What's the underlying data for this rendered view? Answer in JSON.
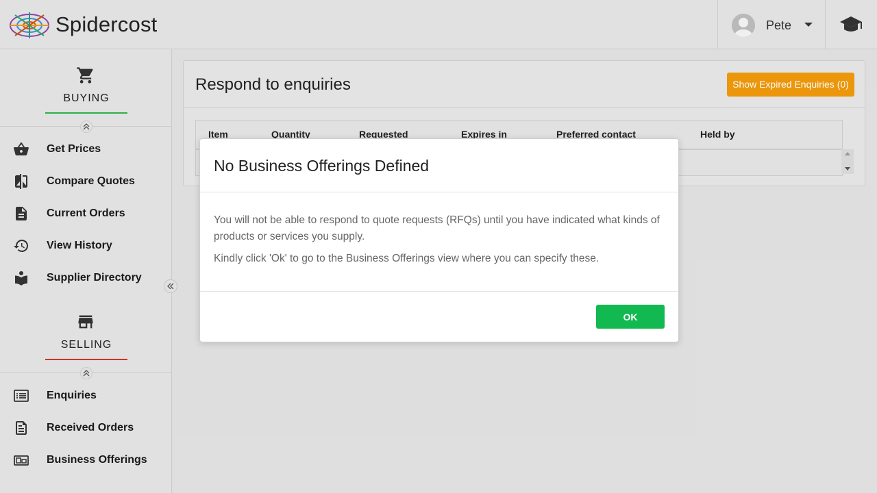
{
  "header": {
    "brand": "Spidercost",
    "user_name": "Pete"
  },
  "sidebar": {
    "buying": {
      "label": "BUYING",
      "underline_color": "#2db34a",
      "items": [
        {
          "label": "Get Prices",
          "icon": "basket-icon"
        },
        {
          "label": "Compare Quotes",
          "icon": "compare-icon"
        },
        {
          "label": "Current Orders",
          "icon": "document-icon"
        },
        {
          "label": "View History",
          "icon": "history-icon"
        },
        {
          "label": "Supplier Directory",
          "icon": "reader-icon"
        }
      ]
    },
    "selling": {
      "label": "SELLING",
      "underline_color": "#d9302a",
      "items": [
        {
          "label": "Enquiries",
          "icon": "list-icon"
        },
        {
          "label": "Received Orders",
          "icon": "order-doc-icon"
        },
        {
          "label": "Business Offerings",
          "icon": "devices-icon"
        }
      ]
    }
  },
  "main": {
    "title": "Respond to enquiries",
    "expired_button": "Show Expired Enquiries (0)",
    "columns": [
      "Item",
      "Quantity",
      "Requested",
      "Expires in",
      "Preferred contact",
      "Held by"
    ]
  },
  "dialog": {
    "title": "No Business Offerings Defined",
    "body_1": "You will not be able to respond to quote requests (RFQs) until you have indicated what kinds of products or services you supply.",
    "body_2": "Kindly click 'Ok' to go to the Business Offerings view where you can specify these.",
    "ok_label": "OK"
  },
  "colors": {
    "accent_orange": "#f09a0c",
    "ok_green": "#11b950"
  }
}
